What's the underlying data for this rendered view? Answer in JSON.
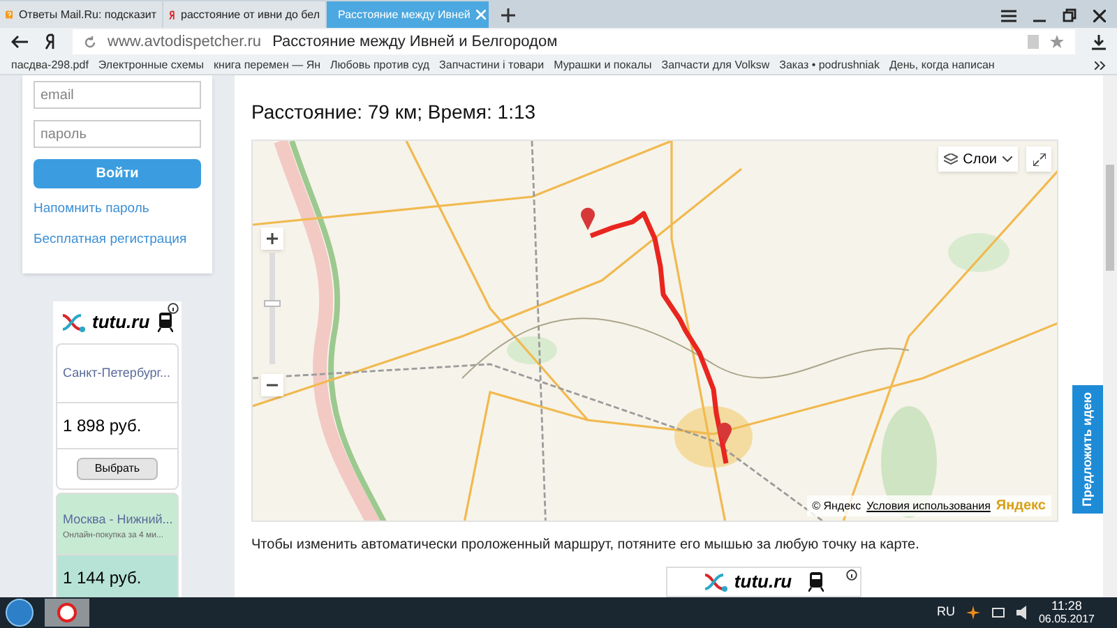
{
  "browser": {
    "tabs": [
      {
        "label": "Ответы Mail.Ru: подсказит",
        "selected": false,
        "kind": "mail"
      },
      {
        "label": "расстояние от ивни до бел",
        "selected": false,
        "kind": "yandex"
      },
      {
        "label": "Расстояние между Ивней",
        "selected": true,
        "kind": "site"
      }
    ],
    "address": {
      "url": "www.avtodispetcher.ru",
      "title": "Расстояние между Ивней и Белгородом"
    },
    "bookmarks": [
      "пасдва-298.pdf",
      "Электронные схемы",
      "книга перемен — Ян",
      "Любовь против суд",
      "Запчастини і товари",
      "Мурашки и покалы",
      "Запчасти для Volksw",
      "Заказ • podrushniak",
      "День, когда написан"
    ]
  },
  "sidebar": {
    "login": {
      "email_placeholder": "email",
      "password_placeholder": "пароль",
      "button": "Войти",
      "links": [
        "Напомнить пароль",
        "Бесплатная регистрация"
      ]
    },
    "ad": {
      "brand": "tutu.ru",
      "offers": [
        {
          "route": "Санкт-Петербург...",
          "price": "1 898 руб.",
          "button": "Выбрать",
          "highlighted": false
        },
        {
          "route": "Москва - Нижний...",
          "note": "Онлайн-покупка за 4 ми...",
          "price": "1 144 руб.",
          "highlighted": true
        }
      ]
    }
  },
  "main": {
    "heading": "Расстояние: 79 км; Время: 1:13",
    "map": {
      "zoom": {
        "level": 0.55
      },
      "layers_button": "Слои",
      "copyright": "© Яндекс",
      "terms": "Условия использования",
      "logo": "Яндекс"
    },
    "hint": "Чтобы изменить автоматически проложенный маршрут, потяните его мышью за любую точку на карте.",
    "ad_brand": "tutu.ru"
  },
  "feedback_tab": "Предложить идею",
  "taskbar": {
    "language": "RU",
    "time": "11:28",
    "date": "06.05.2017"
  }
}
